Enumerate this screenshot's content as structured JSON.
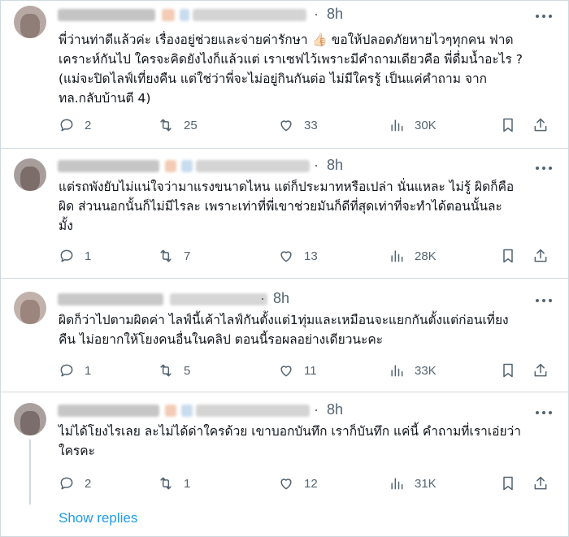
{
  "replies": [
    {
      "time": "8h",
      "text": "พี่ว่านท่าดีแล้วค่ะ เรื่องอยู่ช่วยและจ่ายค่ารักษา 👍🏻 ขอให้ปลอดภัยหายไวๆทุกคน ฟาด\nเคราะห์กันไป ใครจะคิดยังไงก็แล้วแต่ เราเซฟไว้เพราะมีคำถามเดียวคือ พี่ดื่มน้ำอะไร ?\n(แม่จะปิดไลฟ์เที่ยงคืน แต่ใช่ว่าพี่จะไม่อยู่กินกันต่อ ไม่มีใครรู้ เป็นแค่คำถาม จาก\nทล.กลับบ้านตี 4)",
      "replies_count": "2",
      "reposts": "25",
      "likes": "33",
      "views": "30K"
    },
    {
      "time": "8h",
      "text": "แต่รถพังยับไม่แน่ใจว่ามาแรงขนาดไหน แต่ก็ประมาทหรือเปล่า นั่นแหละ ไม่รู้ ผิดก็คือ\nผิด ส่วนนอกนั้นก็ไม่มีไรละ เพราะเท่าที่พี่เขาช่วยมันก็ดีที่สุดเท่าที่จะทำได้ตอนนั้นละ\nมั้ง",
      "replies_count": "1",
      "reposts": "7",
      "likes": "13",
      "views": "28K"
    },
    {
      "time": "8h",
      "text": "ผิดก็ว่าไปตามผิดค่า ไลฟ์นี้เค้าไลฟ์กันตั้งแต่1ทุ่มและเหมือนจะแยกกันตั้งแต่ก่อนเที่ยง\nคืน ไม่อยากให้โยงคนอื่นในคลิป ตอนนี้รอผลอย่างเดียวนะคะ",
      "replies_count": "1",
      "reposts": "5",
      "likes": "11",
      "views": "33K"
    },
    {
      "time": "8h",
      "text": "ไม่ได้โยงไรเลย ละไม่ได้ด่าใครด้วย เขาบอกบันทึก เราก็บันทึก แค่นี้ คำถามที่เราเอ่ยว่า\nใครคะ",
      "replies_count": "2",
      "reposts": "1",
      "likes": "12",
      "views": "31K"
    }
  ],
  "show_replies": "Show replies",
  "colors": {
    "muted": "#536471",
    "link": "#1d9bf0",
    "separator": "#cfd9de"
  },
  "icons": [
    "reply-icon",
    "repost-icon",
    "like-icon",
    "views-icon",
    "bookmark-icon",
    "share-icon",
    "more-icon"
  ]
}
